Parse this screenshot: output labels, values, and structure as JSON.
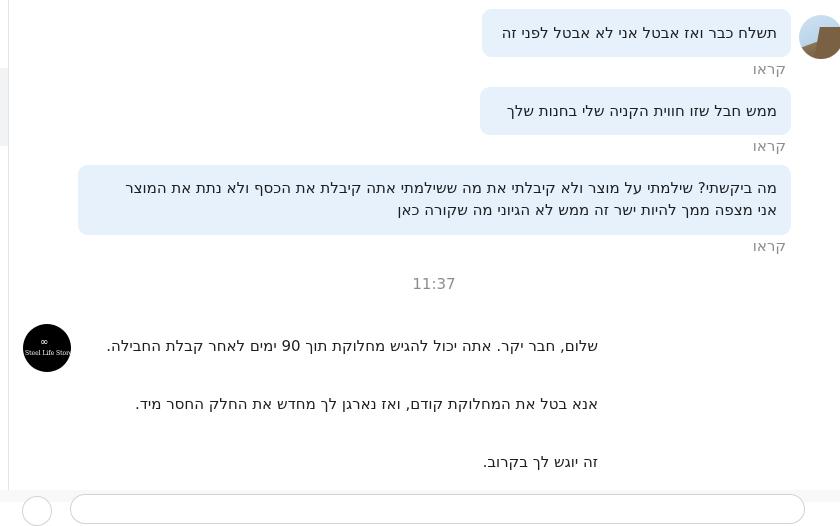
{
  "thread": {
    "outgoing": [
      {
        "text": "תשלח כבר ואז אבטל אני לא אבטל לפני זה",
        "status": "קראו"
      },
      {
        "text": "ממש חבל שזו חווית הקניה שלי בחנות שלך",
        "status": "קראו"
      },
      {
        "line1": "מה ביקשתי? שילמתי על מוצר ולא קיבלתי את מה ששילמתי אתה קיבלת את הכסף ולא נתת את המוצר",
        "line2": "אני מצפה ממך להיות ישר זה ממש לא הגיוני מה שקורה כאן",
        "status": "קראו"
      }
    ],
    "timestamp": "11:37",
    "store_logo_text": "Steel Life Store",
    "incoming": [
      "שלום, חבר יקר. אתה יכול להגיש מחלוקת תוך 90 ימים לאחר קבלת החבילה.",
      "אנא בטל את המחלוקת קודם, ואז נארגן לך מחדש את החלק החסר מיד.",
      "זה יוגש לך בקרוב."
    ]
  }
}
